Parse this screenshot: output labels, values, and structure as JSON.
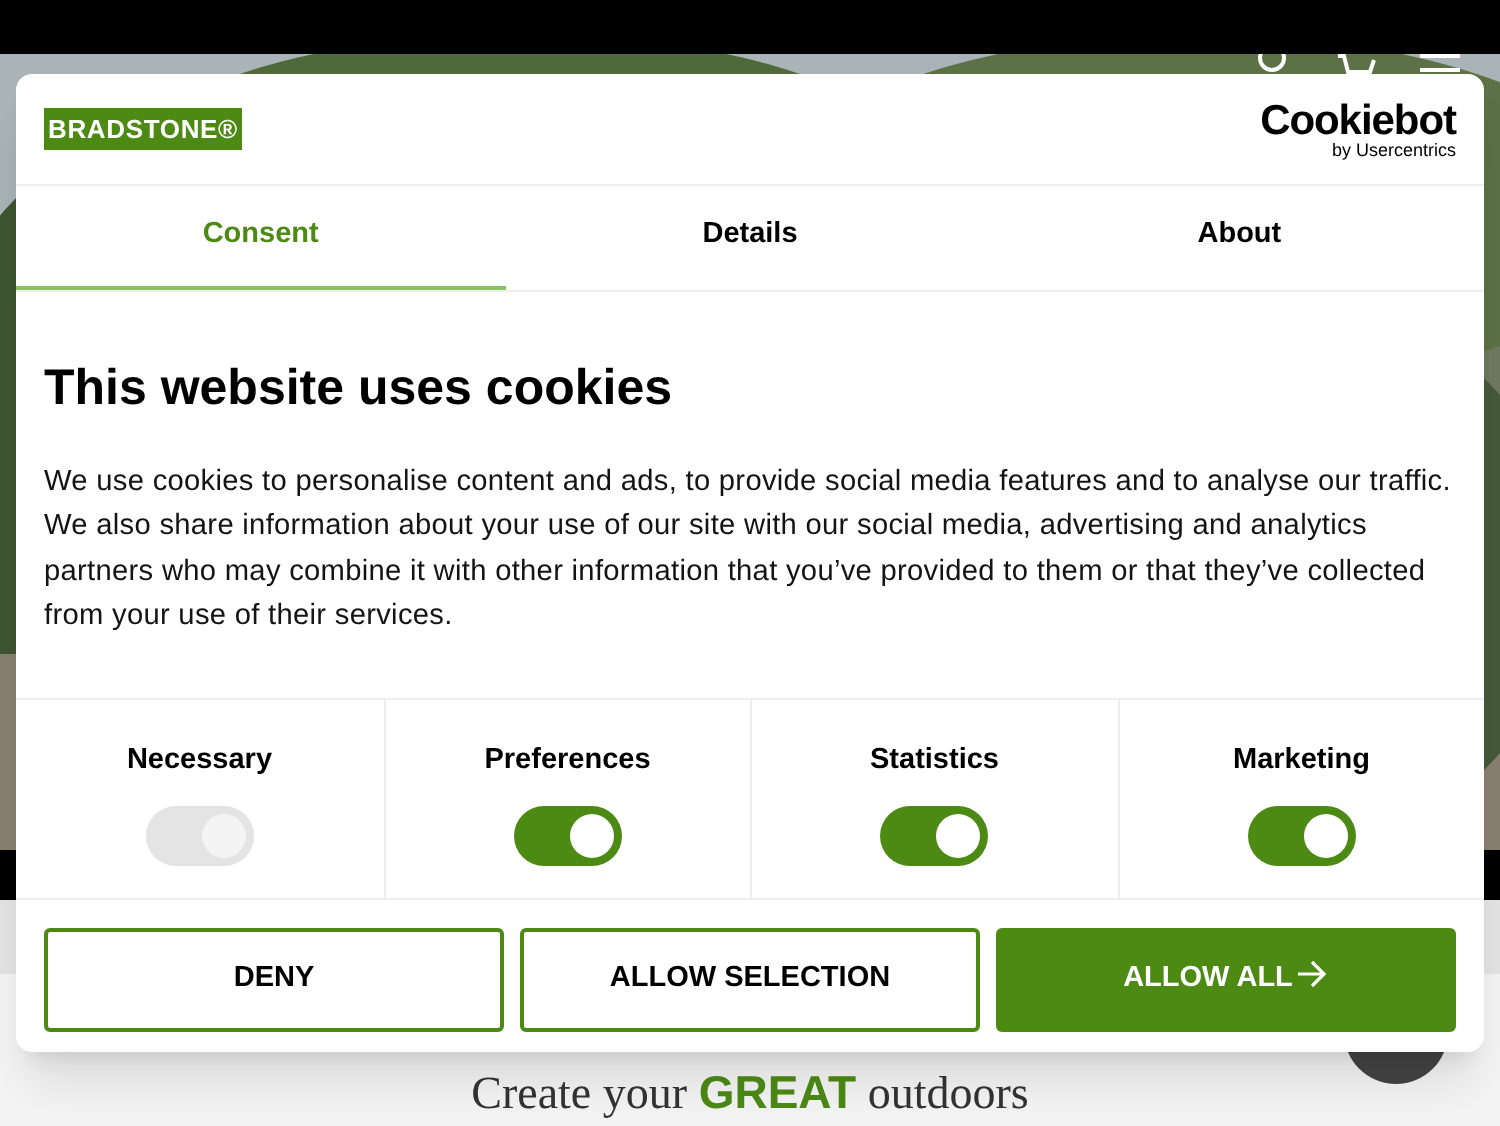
{
  "site": {
    "headline": "Create your **GREAT** outdoors"
  },
  "dialog": {
    "logo": "BRADSTONE®",
    "provider": "Cookiebot",
    "provider_sub": "by Usercentrics",
    "tabs": [
      {
        "label": "Consent",
        "selected": true
      },
      {
        "label": "Details",
        "selected": false
      },
      {
        "label": "About",
        "selected": false
      }
    ],
    "title": "This website uses cookies",
    "body": "We use cookies to personalise content and ads, to provide social media features and to analyse our traffic. We also share information about your use of our site with our social media, advertising and analytics partners who may combine it with other information that you’ve provided to them or that they’ve collected from your use of their services.",
    "categories": [
      {
        "label": "Necessary",
        "on": true,
        "disabled": true
      },
      {
        "label": "Preferences",
        "on": true,
        "disabled": false
      },
      {
        "label": "Statistics",
        "on": true,
        "disabled": false
      },
      {
        "label": "Marketing",
        "on": true,
        "disabled": false
      }
    ],
    "buttons": [
      {
        "label": "DENY",
        "kind": "outline"
      },
      {
        "label": "ALLOW SELECTION",
        "kind": "outline"
      },
      {
        "label": "ALLOW ALL",
        "kind": "primary"
      }
    ]
  }
}
